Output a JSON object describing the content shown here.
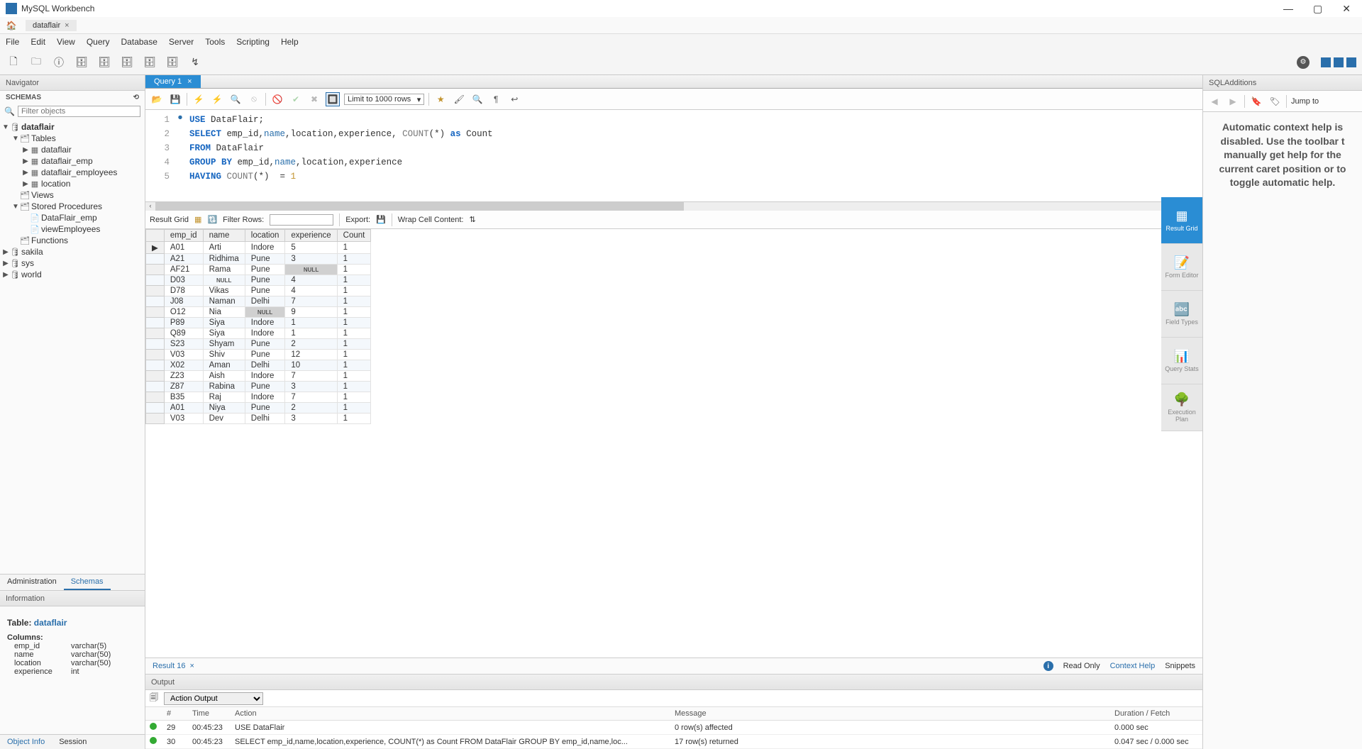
{
  "title": "MySQL Workbench",
  "connection_tab": "dataflair",
  "menu": [
    "File",
    "Edit",
    "View",
    "Query",
    "Database",
    "Server",
    "Tools",
    "Scripting",
    "Help"
  ],
  "navigator": {
    "title": "Navigator",
    "schemas_label": "SCHEMAS",
    "filter_placeholder": "Filter objects"
  },
  "tree": {
    "db": "dataflair",
    "tables_label": "Tables",
    "tables": [
      "dataflair",
      "dataflair_emp",
      "dataflair_employees",
      "location"
    ],
    "views_label": "Views",
    "sp_label": "Stored Procedures",
    "sps": [
      "DataFlair_emp",
      "viewEmployees"
    ],
    "functions_label": "Functions",
    "other_dbs": [
      "sakila",
      "sys",
      "world"
    ]
  },
  "nav_tabs": [
    "Administration",
    "Schemas"
  ],
  "information_label": "Information",
  "table_info": {
    "prefix": "Table: ",
    "name": "dataflair",
    "columns_label": "Columns:",
    "columns": [
      {
        "name": "emp_id",
        "type": "varchar(5)"
      },
      {
        "name": "name",
        "type": "varchar(50)"
      },
      {
        "name": "location",
        "type": "varchar(50)"
      },
      {
        "name": "experience",
        "type": "int"
      }
    ]
  },
  "bottom_tabs": [
    "Object Info",
    "Session"
  ],
  "query_tab": "Query 1",
  "sql_limit": "Limit to 1000 rows",
  "code": {
    "lines": [
      "1",
      "2",
      "3",
      "4",
      "5"
    ],
    "l1": {
      "a": "USE",
      "b": " DataFlair;"
    },
    "l2": {
      "a": "SELECT",
      "b": " emp_id,",
      "c": "name",
      "d": ",location,experience, ",
      "e": "COUNT",
      "f": "(*) ",
      "g": "as",
      "h": " Count"
    },
    "l3": {
      "a": "FROM",
      "b": " DataFlair"
    },
    "l4": {
      "a": "GROUP BY",
      "b": " emp_id,",
      "c": "name",
      "d": ",location,experience"
    },
    "l5": {
      "a": "HAVING",
      "b": " ",
      "c": "COUNT",
      "d": "(*)  = ",
      "e": "1"
    }
  },
  "chart_data": {
    "type": "table",
    "columns": [
      "emp_id",
      "name",
      "location",
      "experience",
      "Count"
    ],
    "rows": [
      [
        "A01",
        "Arti",
        "Indore",
        "5",
        "1"
      ],
      [
        "A21",
        "Ridhima",
        "Pune",
        "3",
        "1"
      ],
      [
        "AF21",
        "Rama",
        "Pune",
        null,
        "1"
      ],
      [
        "D03",
        null,
        "Pune",
        "4",
        "1"
      ],
      [
        "D78",
        "Vikas",
        "Pune",
        "4",
        "1"
      ],
      [
        "J08",
        "Naman",
        "Delhi",
        "7",
        "1"
      ],
      [
        "O12",
        "Nia",
        null,
        "9",
        "1"
      ],
      [
        "P89",
        "Siya",
        "Indore",
        "1",
        "1"
      ],
      [
        "Q89",
        "Siya",
        "Indore",
        "1",
        "1"
      ],
      [
        "S23",
        "Shyam",
        "Pune",
        "2",
        "1"
      ],
      [
        "V03",
        "Shiv",
        "Pune",
        "12",
        "1"
      ],
      [
        "X02",
        "Aman",
        "Delhi",
        "10",
        "1"
      ],
      [
        "Z23",
        "Aish",
        "Indore",
        "7",
        "1"
      ],
      [
        "Z87",
        "Rabina",
        "Pune",
        "3",
        "1"
      ],
      [
        "B35",
        "Raj",
        "Indore",
        "7",
        "1"
      ],
      [
        "A01",
        "Niya",
        "Pune",
        "2",
        "1"
      ],
      [
        "V03",
        "Dev",
        "Delhi",
        "3",
        "1"
      ]
    ]
  },
  "result_toolbar": {
    "grid_label": "Result Grid",
    "filter_label": "Filter Rows:",
    "export_label": "Export:",
    "wrap_label": "Wrap Cell Content:"
  },
  "vtabs": [
    "Result Grid",
    "Form Editor",
    "Field Types",
    "Query Stats",
    "Execution Plan"
  ],
  "result_tab_label": "Result 16",
  "read_only": "Read Only",
  "context_help_tab": "Context Help",
  "snippets_tab": "Snippets",
  "output": {
    "label": "Output",
    "select": "Action Output",
    "headers": [
      "#",
      "Time",
      "Action",
      "Message",
      "Duration / Fetch"
    ],
    "rows": [
      {
        "ok": true,
        "n": "29",
        "t": "00:45:23",
        "a": "USE DataFlair",
        "m": "0 row(s) affected",
        "d": "0.000 sec"
      },
      {
        "ok": true,
        "n": "30",
        "t": "00:45:23",
        "a": "SELECT emp_id,name,location,experience, COUNT(*) as Count FROM DataFlair GROUP BY emp_id,name,loc...",
        "m": "17 row(s) returned",
        "d": "0.047 sec / 0.000 sec"
      }
    ]
  },
  "sql_additions": {
    "title": "SQLAdditions",
    "jump_to": "Jump to",
    "help": "Automatic context help is disabled. Use the toolbar t manually get help for the current caret position or to toggle automatic help."
  }
}
